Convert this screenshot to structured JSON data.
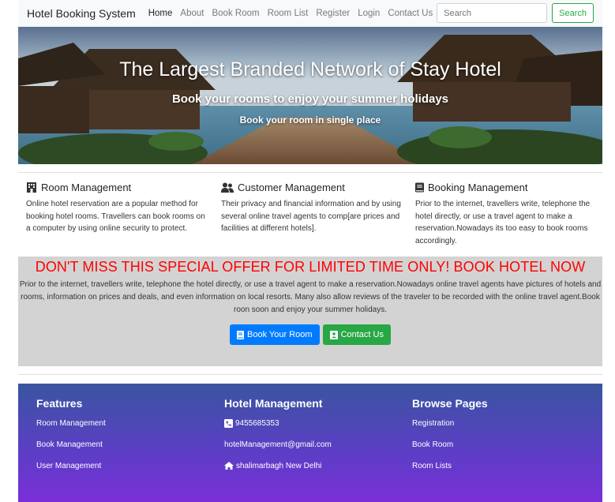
{
  "navbar": {
    "brand": "Hotel Booking System",
    "links": [
      "Home",
      "About",
      "Book Room",
      "Room List",
      "Register",
      "Login",
      "Contact Us"
    ],
    "search_placeholder": "Search",
    "search_button": "Search"
  },
  "hero": {
    "title": "The Largest Branded Network of Stay Hotel",
    "subtitle": "Book your rooms to enjoy your summer holidays",
    "tagline": "Book your room in single place"
  },
  "features": [
    {
      "icon": "hotel-icon",
      "title": "Room Management",
      "text": "Online hotel reservation are a popular method for booking hotel rooms. Travellers can book rooms on a computer by using online security to protect."
    },
    {
      "icon": "users-icon",
      "title": "Customer Management",
      "text": "Their privacy and financial information and by using several online travel agents to comp[are prices and facilities at different hotels]."
    },
    {
      "icon": "book-icon",
      "title": "Booking Management",
      "text": "Prior to the internet, travellers write, telephone the hotel directly, or use a travel agent to make a reservation.Nowadays its too easy to book rooms accordingly."
    }
  ],
  "offer": {
    "heading": "DON'T MISS THIS SPECIAL OFFER FOR LIMITED TIME ONLY! BOOK HOTEL NOW",
    "text": "Prior to the internet, travellers write, telephone the hotel directly, or use a travel agent to make a reservation.Nowadays online travel agents have pictures of hotels and rooms, information on prices and deals, and even information on local resorts. Many also allow reviews of the traveler to be recorded with the online travel agent.Book roon soon and enjoy your summer holidays.",
    "book_button": "Book Your Room",
    "contact_button": "Contact Us",
    "heading_color": "#ff0000"
  },
  "footer": {
    "features": {
      "title": "Features",
      "items": [
        "Room Management",
        "Book Management",
        "User Management"
      ]
    },
    "hotel": {
      "title": "Hotel Management",
      "phone": "9455685353",
      "email": "hotelManagement@gmail.com",
      "address": "shalimarbagh New Delhi"
    },
    "browse": {
      "title": "Browse Pages",
      "items": [
        "Registration",
        "Book Room",
        "Room Lists"
      ]
    }
  },
  "colors": {
    "primary": "#007bff",
    "success": "#28a745",
    "offer_bg": "#d3d3d3"
  }
}
